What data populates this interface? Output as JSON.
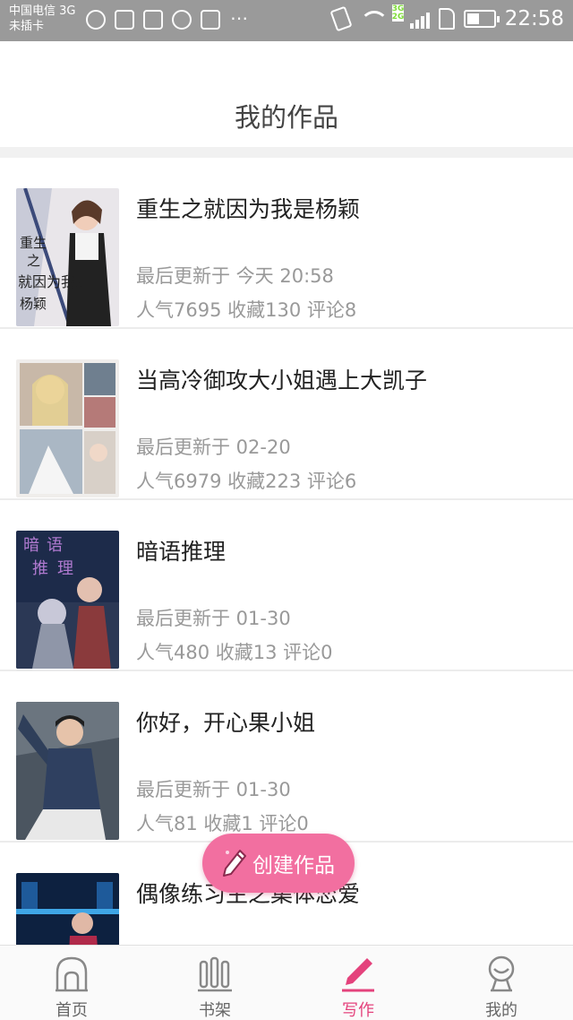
{
  "status_bar": {
    "carrier_line1": "中国电信 3G",
    "carrier_line2": "未插卡",
    "network_badge_top": "3G",
    "network_badge_bottom": "2G",
    "time": "22:58",
    "battery_level": 0.45
  },
  "header": {
    "title": "我的作品"
  },
  "works": [
    {
      "title": "重生之就因为我是杨颖",
      "updated": "最后更新于 今天 20:58",
      "stats": "人气7695 收藏130 评论8",
      "cover_text": [
        "重生",
        "之",
        "就因为我是",
        "杨颖"
      ]
    },
    {
      "title": "当高冷御攻大小姐遇上大凯子",
      "updated": "最后更新于 02-20",
      "stats": "人气6979 收藏223 评论6"
    },
    {
      "title": "暗语推理",
      "updated": "最后更新于 01-30",
      "stats": "人气480 收藏13 评论0",
      "cover_text": [
        "暗",
        "语",
        "推",
        "理"
      ]
    },
    {
      "title": "你好，开心果小姐",
      "updated": "最后更新于 01-30",
      "stats": "人气81 收藏1 评论0"
    },
    {
      "title": "偶像练习生之集体恋爱",
      "updated": "",
      "stats": ""
    }
  ],
  "fab": {
    "label": "创建作品",
    "color": "#f26fa0"
  },
  "bottom_nav": {
    "items": [
      {
        "label": "首页",
        "icon": "home-icon"
      },
      {
        "label": "书架",
        "icon": "bookshelf-icon"
      },
      {
        "label": "写作",
        "icon": "pen-icon",
        "active": true
      },
      {
        "label": "我的",
        "icon": "profile-icon"
      }
    ],
    "active_color": "#e4427c"
  }
}
